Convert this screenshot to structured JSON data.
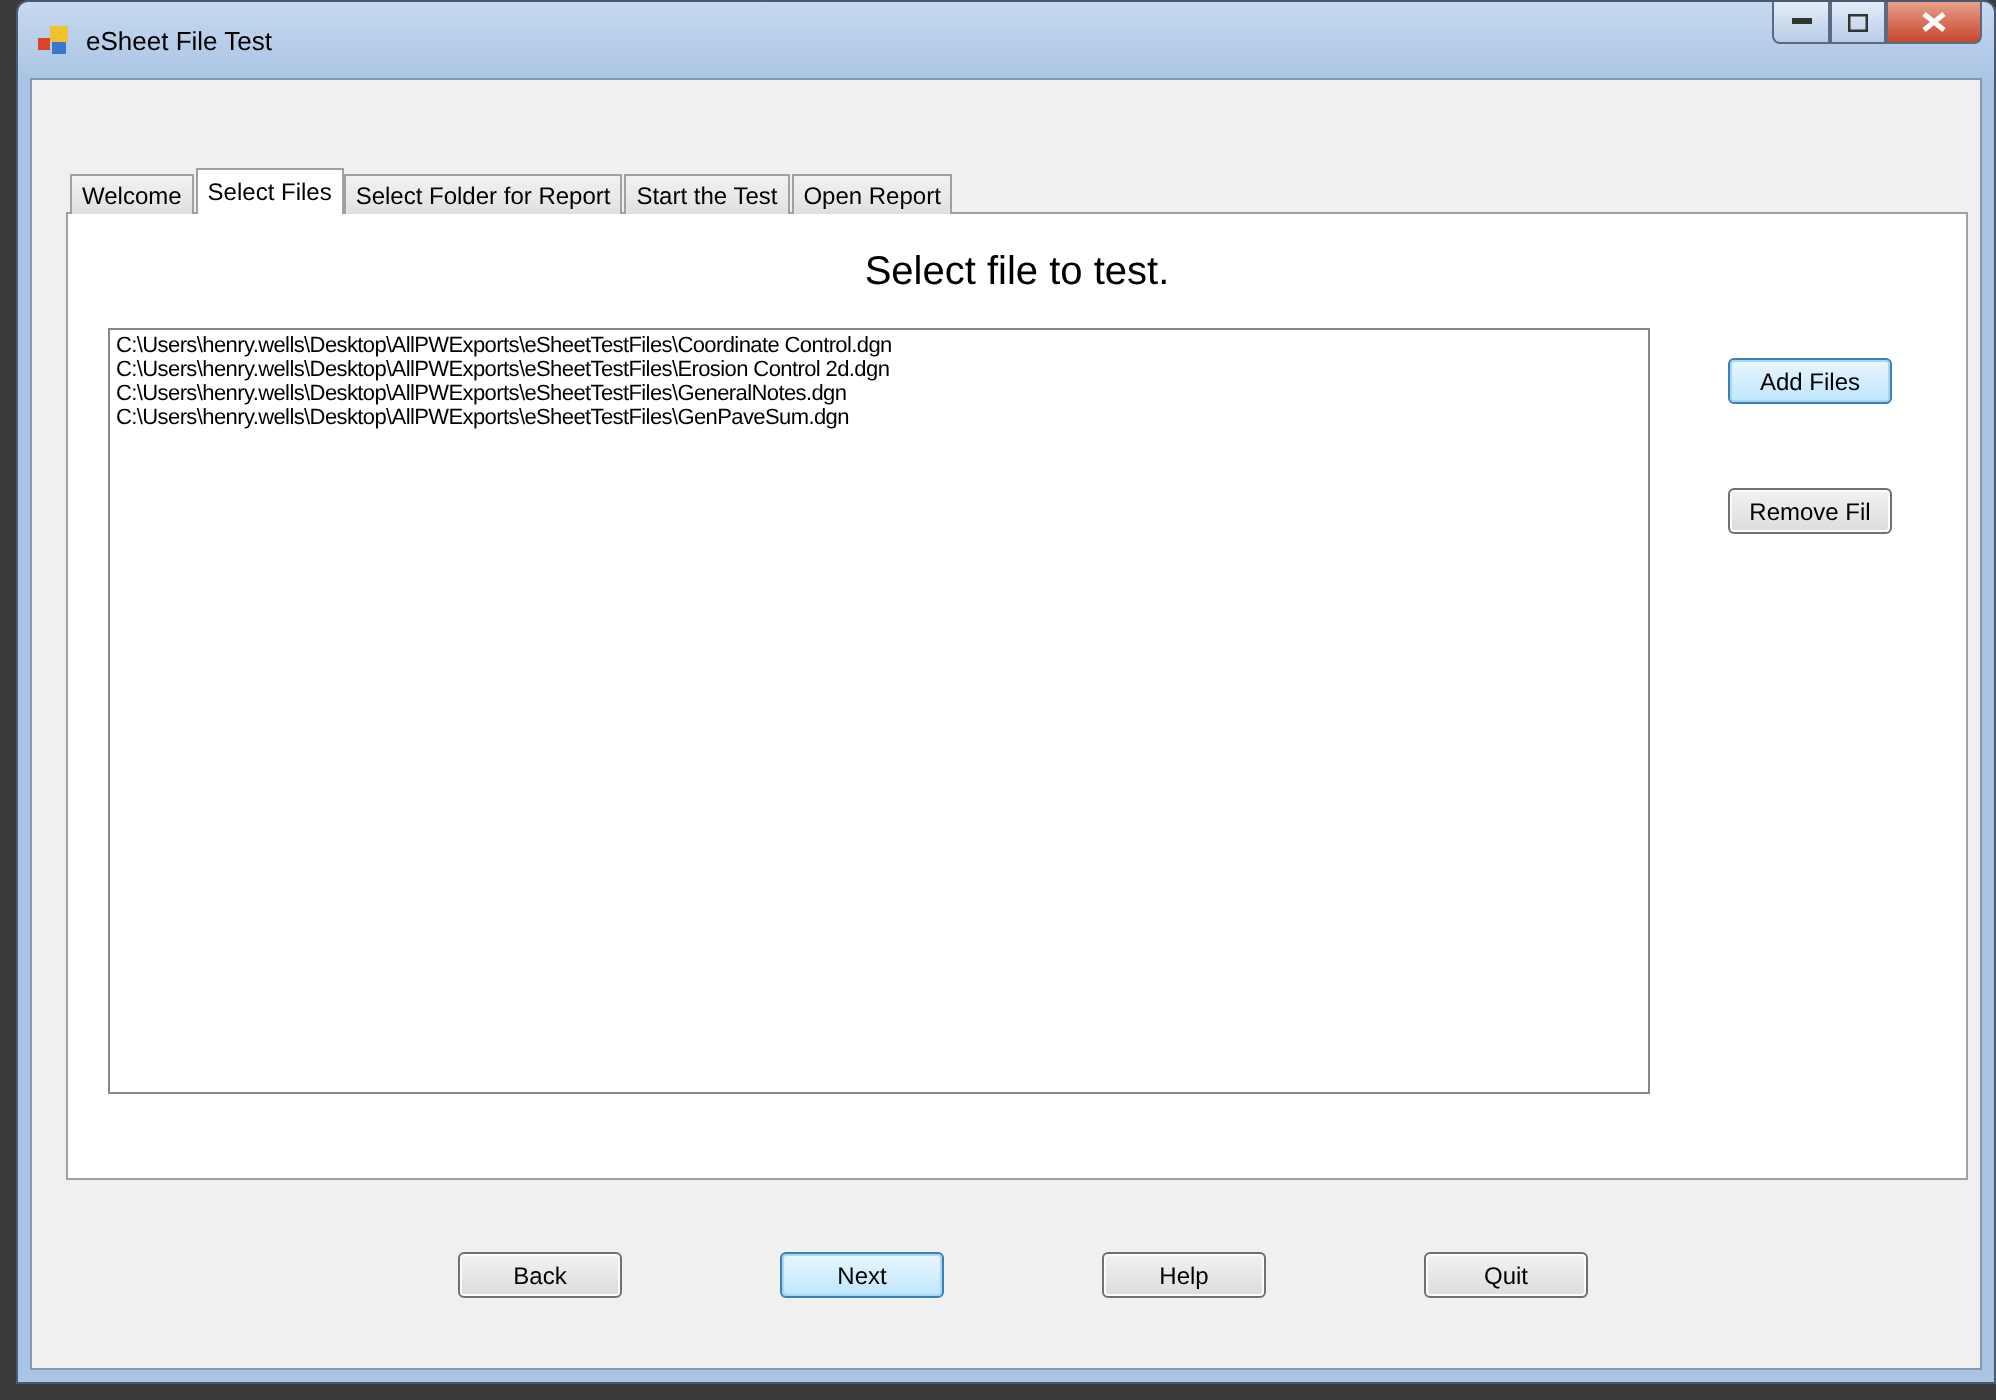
{
  "window": {
    "title": "eSheet File Test"
  },
  "tabs": [
    {
      "label": "Welcome",
      "selected": false
    },
    {
      "label": "Select Files",
      "selected": true
    },
    {
      "label": "Select Folder for Report",
      "selected": false
    },
    {
      "label": "Start the Test",
      "selected": false
    },
    {
      "label": "Open Report",
      "selected": false
    }
  ],
  "heading": "Select file to test.",
  "files": [
    "C:\\Users\\henry.wells\\Desktop\\AllPWExports\\eSheetTestFiles\\Coordinate Control.dgn",
    "C:\\Users\\henry.wells\\Desktop\\AllPWExports\\eSheetTestFiles\\Erosion Control 2d.dgn",
    "C:\\Users\\henry.wells\\Desktop\\AllPWExports\\eSheetTestFiles\\GeneralNotes.dgn",
    "C:\\Users\\henry.wells\\Desktop\\AllPWExports\\eSheetTestFiles\\GenPaveSum.dgn"
  ],
  "side_buttons": [
    {
      "label": "Add Files",
      "highlighted": true
    },
    {
      "label": "Remove Fil",
      "highlighted": false
    }
  ],
  "nav_buttons": [
    {
      "label": "Back",
      "highlighted": false
    },
    {
      "label": "Next",
      "highlighted": true
    },
    {
      "label": "Help",
      "highlighted": false
    },
    {
      "label": "Quit",
      "highlighted": false
    }
  ]
}
